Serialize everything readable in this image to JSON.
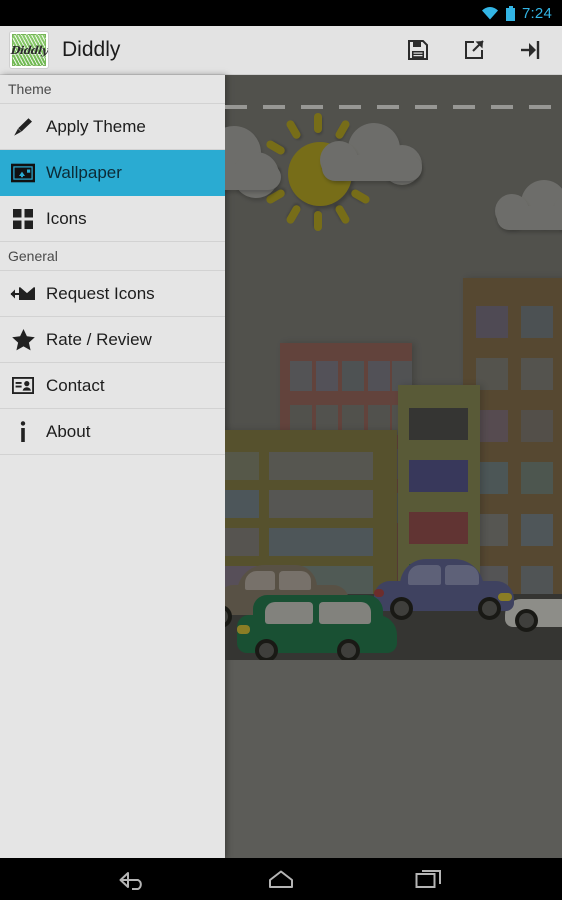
{
  "status_bar": {
    "time": "7:24",
    "wifi_icon": "wifi-icon",
    "battery_icon": "battery-icon",
    "accent_color": "#33B5E5"
  },
  "app_bar": {
    "logo_label": "Diddly",
    "logo_icon": "app-logo-icon",
    "title": "Diddly",
    "background_color": "#E3E3E3",
    "actions": [
      {
        "name": "save-button",
        "icon": "floppy-disk-icon"
      },
      {
        "name": "share-button",
        "icon": "share-external-icon"
      },
      {
        "name": "apply-button",
        "icon": "arrow-into-bracket-icon"
      }
    ]
  },
  "drawer": {
    "background_color": "#E5E5E5",
    "highlight_color": "#2AABD2",
    "sections": [
      {
        "header": "Theme",
        "items": [
          {
            "label": "Apply Theme",
            "icon": "paintbrush-icon",
            "selected": false
          },
          {
            "label": "Wallpaper",
            "icon": "image-upload-icon",
            "selected": true
          },
          {
            "label": "Icons",
            "icon": "grid-squares-icon",
            "selected": false
          }
        ]
      },
      {
        "header": "General",
        "items": [
          {
            "label": "Request Icons",
            "icon": "envelope-arrow-icon",
            "selected": false
          },
          {
            "label": "Rate / Review",
            "icon": "star-icon",
            "selected": false
          },
          {
            "label": "Contact",
            "icon": "contact-card-icon",
            "selected": false
          },
          {
            "label": "About",
            "icon": "info-icon",
            "selected": false
          }
        ]
      }
    ]
  },
  "preview": {
    "name": "wallpaper-preview",
    "description": "Flat illustration city wallpaper preview, dimmed",
    "sky_color": "#63635E",
    "ground_color": "#5C5C58",
    "road_color": "#3B3B38",
    "sun_color": "#9a8c14",
    "cloud_color": "#8C8C88",
    "buildings": [
      {
        "name": "olive-building-left",
        "color": "#6b6432"
      },
      {
        "name": "brick-building-mid",
        "color": "#7b4f47"
      },
      {
        "name": "green-tower-mid",
        "color": "#6f7040"
      },
      {
        "name": "brown-building-right",
        "color": "#6a5637"
      }
    ],
    "tower_bands": [
      "#3c3c3a",
      "#3f4073",
      "#7a3a3a",
      "#2d6b36"
    ],
    "cars": [
      {
        "name": "tan-sedan",
        "color": "#6e6454"
      },
      {
        "name": "green-van",
        "color": "#14623a"
      },
      {
        "name": "blue-sedan",
        "color": "#4a4e7a"
      },
      {
        "name": "white-car",
        "color": "#b9b9b4"
      }
    ]
  },
  "nav_bar": {
    "background_color": "#000000",
    "buttons": [
      {
        "name": "back-button",
        "icon": "back-arrow-icon"
      },
      {
        "name": "home-button",
        "icon": "home-icon"
      },
      {
        "name": "recents-button",
        "icon": "recents-squares-icon"
      }
    ]
  }
}
